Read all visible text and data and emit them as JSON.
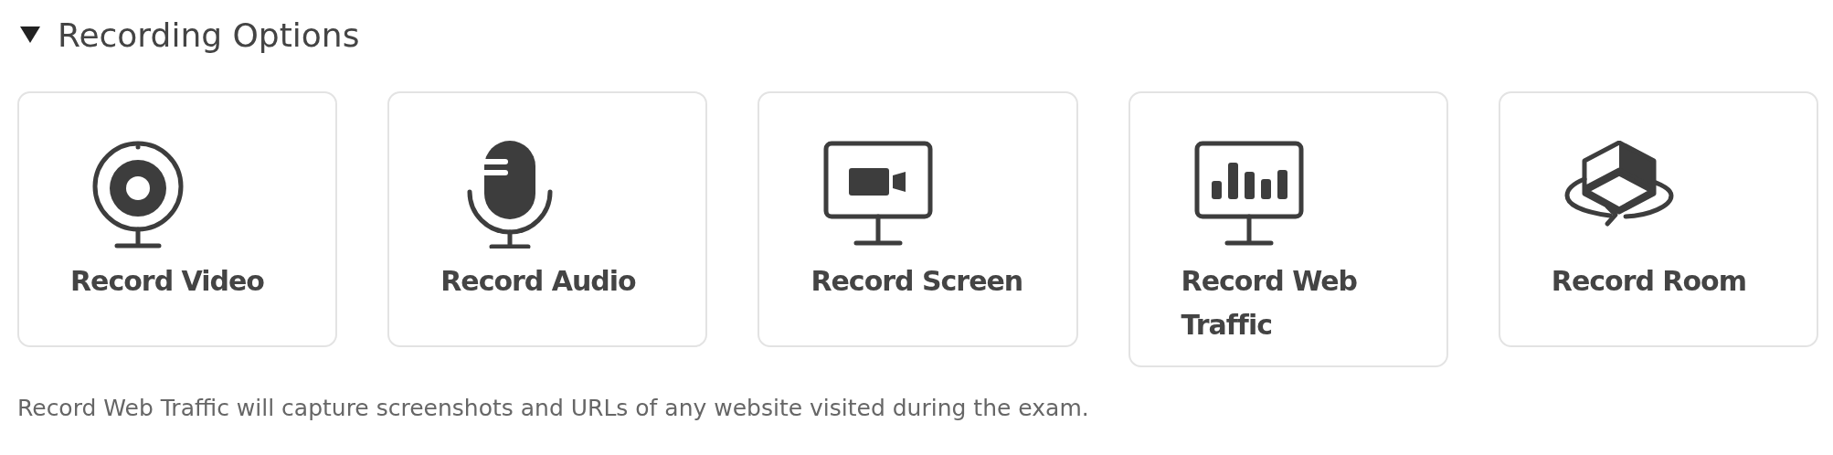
{
  "section": {
    "title": "Recording Options",
    "expanded": true
  },
  "options": [
    {
      "kind": "webcam",
      "label": "Record Video"
    },
    {
      "kind": "microphone",
      "label": "Record Audio"
    },
    {
      "kind": "screen",
      "label": "Record Screen"
    },
    {
      "kind": "traffic",
      "label": "Record Web Traffic"
    },
    {
      "kind": "room",
      "label": "Record Room"
    }
  ],
  "note": "Record Web Traffic will capture screenshots and URLs of any website visited during the exam."
}
